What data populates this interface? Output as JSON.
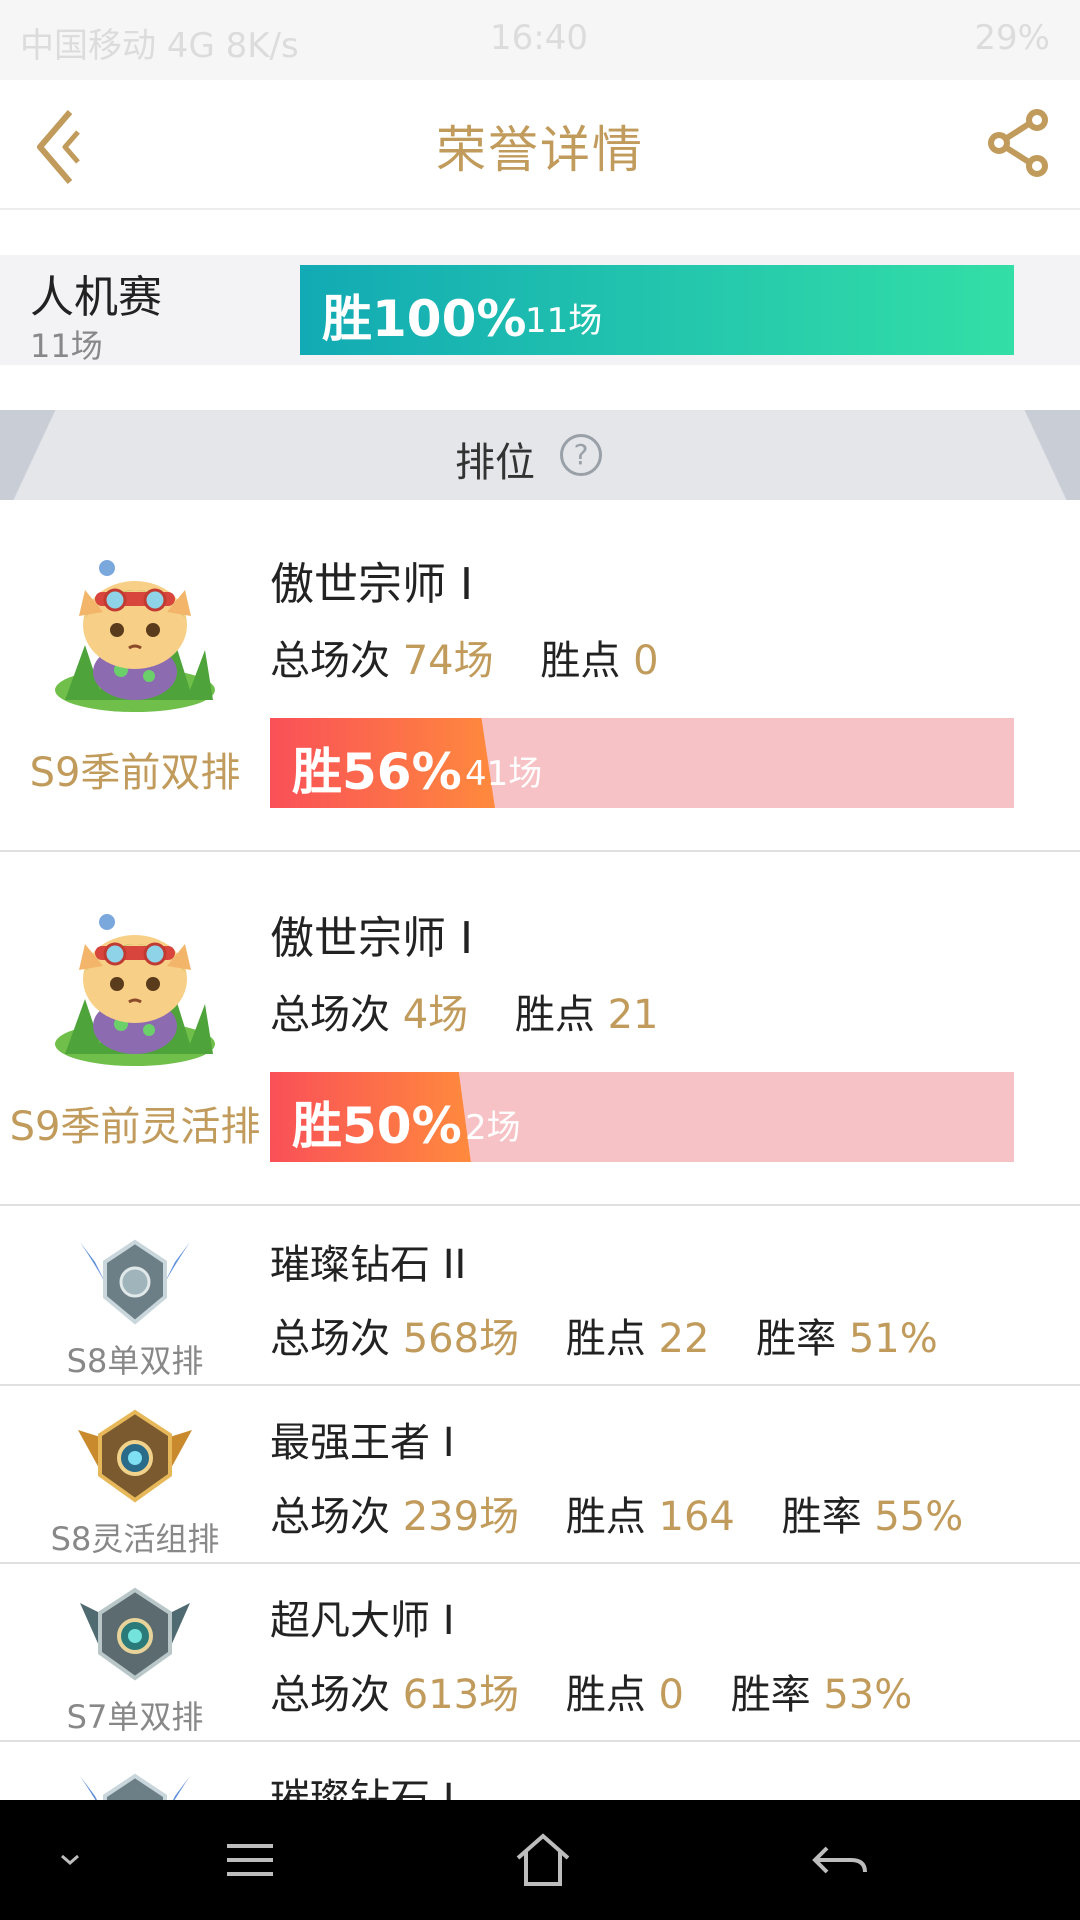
{
  "status_bar": {
    "left": "中国移动 4G 8K/s",
    "time": "16:40",
    "battery": "29%"
  },
  "header": {
    "title": "荣誉详情"
  },
  "ai_match": {
    "name": "人机赛",
    "count": "11场",
    "win_label": "胜100%",
    "games": "11场",
    "win_rate": 1.0
  },
  "rank_section": {
    "title": "排位"
  },
  "big_entries": [
    {
      "season": "S9季前双排",
      "tier": "傲世宗师 I",
      "total_label": "总场次",
      "total_value": "74场",
      "points_label": "胜点",
      "points_value": "0",
      "win_label": "胜56%",
      "games": "41场",
      "win_rate": 0.56
    },
    {
      "season": "S9季前灵活排",
      "tier": "傲世宗师 I",
      "total_label": "总场次",
      "total_value": "4场",
      "points_label": "胜点",
      "points_value": "21",
      "win_label": "胜50%",
      "games": "2场",
      "win_rate": 0.5
    }
  ],
  "small_entries": [
    {
      "season": "S8单双排",
      "tier": "璀璨钻石 II",
      "total_label": "总场次",
      "total_value": "568场",
      "points_label": "胜点",
      "points_value": "22",
      "rate_label": "胜率",
      "rate_value": "51%"
    },
    {
      "season": "S8灵活组排",
      "tier": "最强王者 I",
      "total_label": "总场次",
      "total_value": "239场",
      "points_label": "胜点",
      "points_value": "164",
      "rate_label": "胜率",
      "rate_value": "55%"
    },
    {
      "season": "S7单双排",
      "tier": "超凡大师 I",
      "total_label": "总场次",
      "total_value": "613场",
      "points_label": "胜点",
      "points_value": "0",
      "rate_label": "胜率",
      "rate_value": "53%"
    },
    {
      "season": "",
      "tier": "璀璨钻石 I",
      "total_label": "",
      "total_value": "",
      "points_label": "",
      "points_value": "",
      "rate_label": "",
      "rate_value": ""
    }
  ],
  "colors": {
    "gold": "#c19b5b",
    "ai_bar_start": "#12aab4",
    "ai_bar_end": "#33dfa6",
    "rank_bar_start": "#fa5058",
    "rank_bar_end": "#ff8a3d",
    "rank_bar_track": "#f6c2c5"
  }
}
